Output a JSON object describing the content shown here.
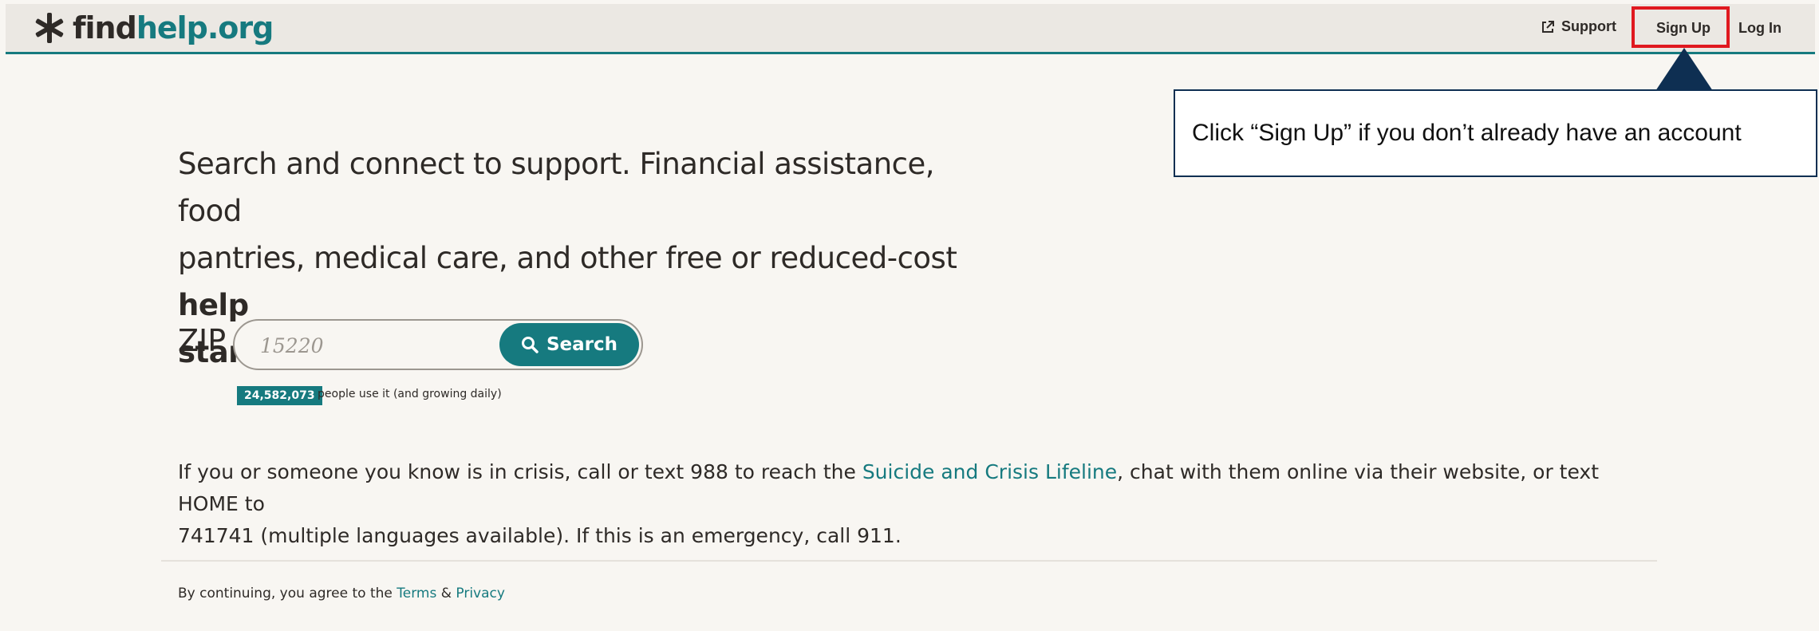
{
  "header": {
    "logo_find": "find",
    "logo_help": "help.org",
    "nav": {
      "support": "Support",
      "sign_up": "Sign Up",
      "log_in": "Log In"
    }
  },
  "callout": {
    "text": "Click “Sign Up” if you don’t already have an account"
  },
  "hero": {
    "line1": "Search and connect to support. Financial assistance, food",
    "line2_prefix": "pantries, medical care, and other free or reduced-cost ",
    "line2_bold": "help",
    "line3_bold": "starts here:"
  },
  "search": {
    "zip_label": "ZIP",
    "placeholder": "15220",
    "button_label": "Search",
    "count": "24,582,073",
    "count_text": "people use it (and growing daily)"
  },
  "crisis": {
    "before": "If you or someone you know is in crisis, call or text 988 to reach the ",
    "link": "Suicide and Crisis Lifeline",
    "after1": ", chat with them online via their website, or text HOME to",
    "after2": "741741 (multiple languages available). If this is an emergency, call 911."
  },
  "footer": {
    "prefix": "By continuing, you agree to the ",
    "terms": "Terms",
    "amp": " & ",
    "privacy": "Privacy"
  },
  "colors": {
    "brand": "#167a7f",
    "background": "#f8f6f2",
    "header_bg": "#ebe8e3",
    "highlight": "#e0191f",
    "callout_border": "#0e2f52"
  }
}
